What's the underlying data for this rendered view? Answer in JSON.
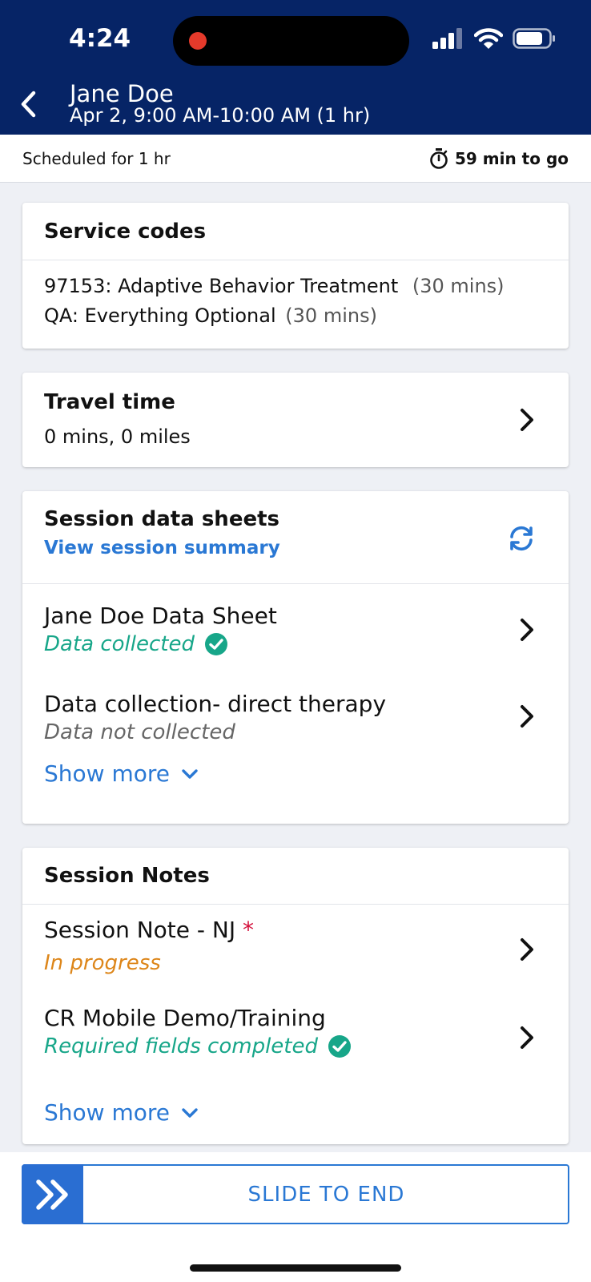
{
  "status_bar": {
    "time": "4:24"
  },
  "header": {
    "client_name": "Jane Doe",
    "appointment": "Apr 2, 9:00 AM-10:00 AM (1 hr)"
  },
  "schedule": {
    "scheduled_text": "Scheduled for 1 hr",
    "remaining_text": "59 min to go"
  },
  "service_codes": {
    "title": "Service codes",
    "codes": [
      {
        "name": "97153: Adaptive Behavior Treatment",
        "duration": "(30 mins)"
      },
      {
        "name": "QA: Everything Optional",
        "duration": "(30 mins)"
      }
    ]
  },
  "travel_time": {
    "title": "Travel time",
    "value": "0 mins, 0 miles"
  },
  "data_sheets": {
    "title": "Session data sheets",
    "summary_link": "View session summary",
    "items": [
      {
        "title": "Jane Doe Data Sheet",
        "status": "Data collected"
      },
      {
        "title": "Data collection- direct therapy",
        "status": "Data not collected"
      }
    ],
    "show_more": "Show more"
  },
  "session_notes": {
    "title": "Session Notes",
    "items": [
      {
        "title": "Session Note - NJ",
        "required_mark": "*",
        "status": "In progress"
      },
      {
        "title": "CR Mobile Demo/Training",
        "status": "Required fields completed"
      }
    ],
    "show_more": "Show more"
  },
  "slider": {
    "label": "SLIDE TO END"
  },
  "colors": {
    "header_bg": "#062466",
    "accent_blue": "#2a78d4",
    "success_green": "#17a689",
    "progress_orange": "#dd861a",
    "required_red": "#d4113c"
  }
}
